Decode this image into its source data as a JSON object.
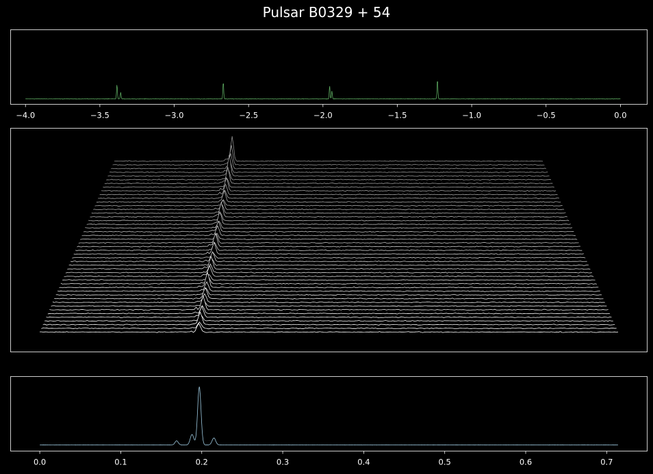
{
  "title": "Pulsar B0329 + 54",
  "colors": {
    "background": "#000000",
    "axes": "#ffffff",
    "top_line": "#66bb6a",
    "waterfall_line": "#ffffff",
    "bottom_line": "#9ecae1"
  },
  "chart_data": [
    {
      "type": "line",
      "panel": "top-time-series",
      "title": "",
      "xlabel": "",
      "ylabel": "",
      "xlim": [
        -4.1,
        0.18
      ],
      "x_ticks": [
        -4.0,
        -3.5,
        -3.0,
        -2.5,
        -2.0,
        -1.5,
        -1.0,
        -0.5,
        0.0
      ],
      "x_tick_labels": [
        "−4.0",
        "−3.5",
        "−3.0",
        "−2.5",
        "−2.0",
        "−1.5",
        "−1.0",
        "−0.5",
        "0.0"
      ],
      "y_ticks": [],
      "series": [
        {
          "x_range": [
            -4.0,
            0.0
          ],
          "baseline": 0.05,
          "noise": 0.015,
          "pulses": [
            {
              "x": -3.385,
              "height": 0.55
            },
            {
              "x": -3.36,
              "height": 0.25
            },
            {
              "x": -2.67,
              "height": 0.65
            },
            {
              "x": -1.955,
              "height": 0.5
            },
            {
              "x": -1.94,
              "height": 0.3
            },
            {
              "x": -1.23,
              "height": 0.75
            }
          ]
        }
      ]
    },
    {
      "type": "line",
      "panel": "waterfall",
      "title": "",
      "xlabel": "",
      "ylabel": "",
      "n_series": 47,
      "x_ticks": [],
      "y_ticks": [],
      "pulse_phase": 0.275,
      "pulse_heights": [
        0.9,
        0.7,
        1.3,
        0.6,
        1.1,
        0.8,
        1.4,
        0.5,
        0.9,
        1.2,
        0.7,
        1.0,
        1.6,
        0.8,
        0.6,
        1.1,
        0.9,
        1.3,
        0.7,
        1.0,
        0.5,
        1.2,
        0.8,
        1.4,
        0.9,
        0.6,
        1.0,
        1.1,
        0.7,
        1.3,
        0.8,
        1.5,
        0.9,
        1.0,
        0.6,
        1.2,
        0.8,
        1.1,
        1.4,
        0.9,
        1.7,
        1.0,
        2.2,
        1.2,
        1.6,
        2.0,
        2.6
      ]
    },
    {
      "type": "line",
      "panel": "bottom-profile",
      "title": "",
      "xlabel": "",
      "ylabel": "",
      "xlim": [
        -0.036,
        0.75
      ],
      "x_ticks": [
        0.0,
        0.1,
        0.2,
        0.3,
        0.4,
        0.5,
        0.6,
        0.7
      ],
      "x_tick_labels": [
        "0.0",
        "0.1",
        "0.2",
        "0.3",
        "0.4",
        "0.5",
        "0.6",
        "0.7"
      ],
      "y_ticks": [],
      "series": [
        {
          "x_range": [
            0.0,
            0.714
          ],
          "components": [
            {
              "center": 0.169,
              "amplitude": 0.07,
              "width": 0.002
            },
            {
              "center": 0.188,
              "amplitude": 0.18,
              "width": 0.0022
            },
            {
              "center": 0.197,
              "amplitude": 1.0,
              "width": 0.0021
            },
            {
              "center": 0.215,
              "amplitude": 0.12,
              "width": 0.0022
            }
          ]
        }
      ]
    }
  ]
}
